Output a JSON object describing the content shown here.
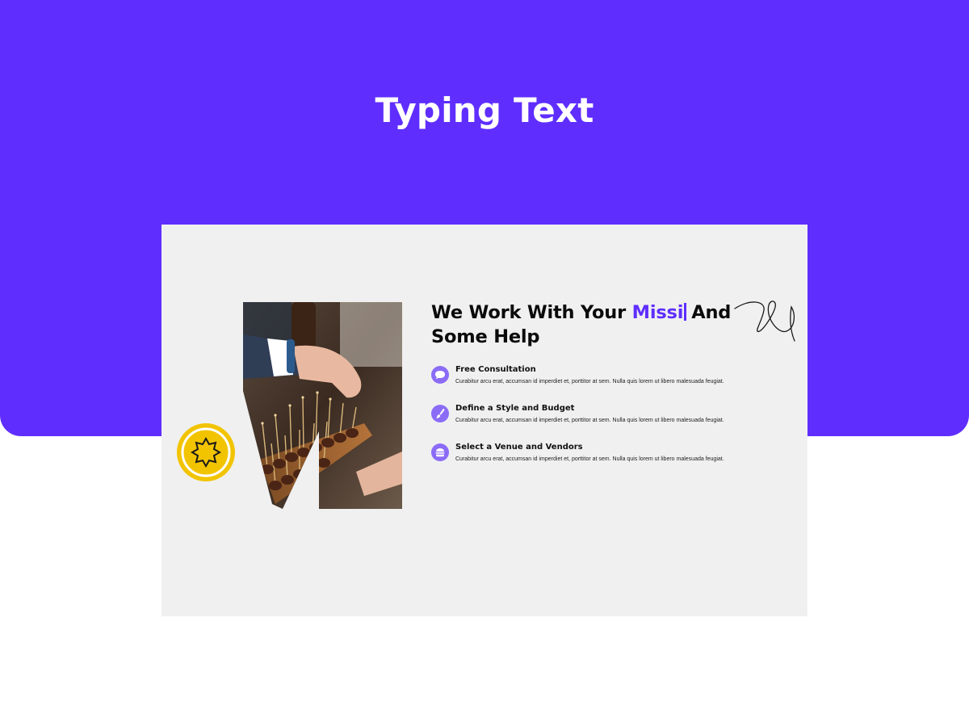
{
  "banner": {
    "title": "Typing Text",
    "color": "#5f2eff"
  },
  "section": {
    "headline_before": "We Work With Your ",
    "headline_typed": "Missi",
    "headline_after": "And Some Help",
    "accent_color": "#5f2eff",
    "badge_icon": "star-burst-icon",
    "features": [
      {
        "icon": "chat-bubble-icon",
        "title": "Free Consultation",
        "text": "Curabitur arcu erat, accumsan id imperdiet et, porttitor at sem. Nulla quis lorem ut libero malesuada feugiat."
      },
      {
        "icon": "paintbrush-icon",
        "title": "Define a Style and Budget",
        "text": "Curabitur arcu erat, accumsan id imperdiet et, porttitor at sem. Nulla quis lorem ut libero malesuada feugiat."
      },
      {
        "icon": "burger-icon",
        "title": "Select a Venue and Vendors",
        "text": "Curabitur arcu erat, accumsan id imperdiet et, porttitor at sem. Nulla quis lorem ut libero malesuada feugiat."
      }
    ]
  }
}
